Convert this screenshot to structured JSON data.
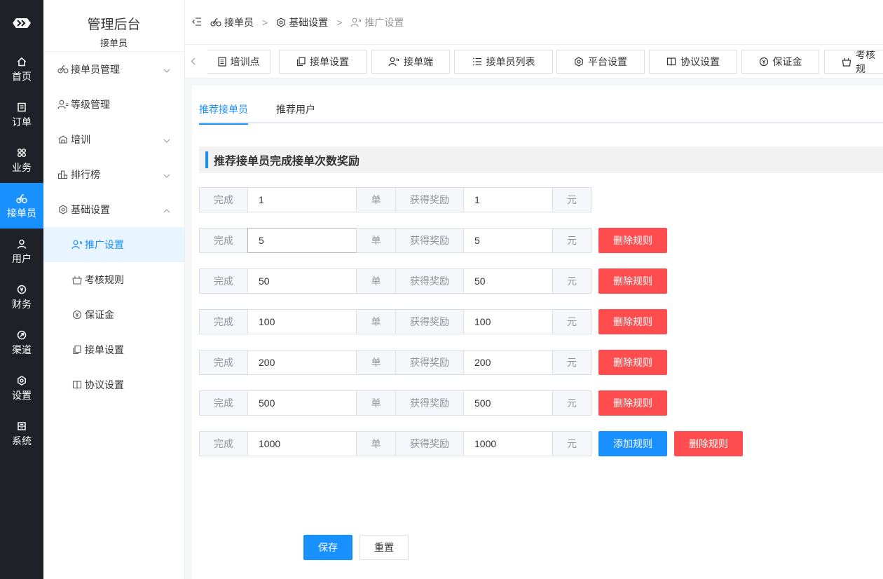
{
  "rail": {
    "items": [
      {
        "label": "首页",
        "icon": "home-icon"
      },
      {
        "label": "订单",
        "icon": "order-icon"
      },
      {
        "label": "业务",
        "icon": "business-icon"
      },
      {
        "label": "接单员",
        "icon": "bike-icon"
      },
      {
        "label": "用户",
        "icon": "user-icon"
      },
      {
        "label": "财务",
        "icon": "finance-icon"
      },
      {
        "label": "渠道",
        "icon": "channel-icon"
      },
      {
        "label": "设置",
        "icon": "settings-icon"
      },
      {
        "label": "系统",
        "icon": "system-icon"
      }
    ],
    "active_index": 3,
    "active_color": "#1890ff"
  },
  "sidebar": {
    "title": "管理后台",
    "subtitle": "接单员",
    "items": [
      {
        "label": "接单员管理"
      },
      {
        "label": "等级管理"
      },
      {
        "label": "培训"
      },
      {
        "label": "排行榜"
      },
      {
        "label": "基础设置"
      },
      {
        "label": "推广设置"
      },
      {
        "label": "考核规则"
      },
      {
        "label": "保证金"
      },
      {
        "label": "接单设置"
      },
      {
        "label": "协议设置"
      }
    ]
  },
  "breadcrumb": {
    "items": [
      "接单员",
      "基础设置",
      "推广设置"
    ],
    "separator": ">"
  },
  "tags": {
    "items": [
      "培训点",
      "接单设置",
      "接单端",
      "接单员列表",
      "平台设置",
      "协议设置",
      "保证金",
      "考核规"
    ]
  },
  "tabs": {
    "items": [
      "推荐接单员",
      "推荐用户"
    ],
    "active_index": 0
  },
  "section": {
    "title": "推荐接单员完成接单次数奖励"
  },
  "rule_labels": {
    "complete": "完成",
    "unit": "单",
    "reward": "获得奖励",
    "currency": "元",
    "add": "添加规则",
    "delete": "删除规则"
  },
  "rules": [
    {
      "orders": "1",
      "reward": "1"
    },
    {
      "orders": "5",
      "reward": "5"
    },
    {
      "orders": "50",
      "reward": "50"
    },
    {
      "orders": "100",
      "reward": "100"
    },
    {
      "orders": "200",
      "reward": "200"
    },
    {
      "orders": "500",
      "reward": "500"
    },
    {
      "orders": "1000",
      "reward": "1000"
    }
  ],
  "actions": {
    "save": "保存",
    "reset": "重置"
  },
  "colors": {
    "primary": "#1890ff",
    "danger": "#ff4d4f",
    "rail_bg": "#1e2127"
  }
}
